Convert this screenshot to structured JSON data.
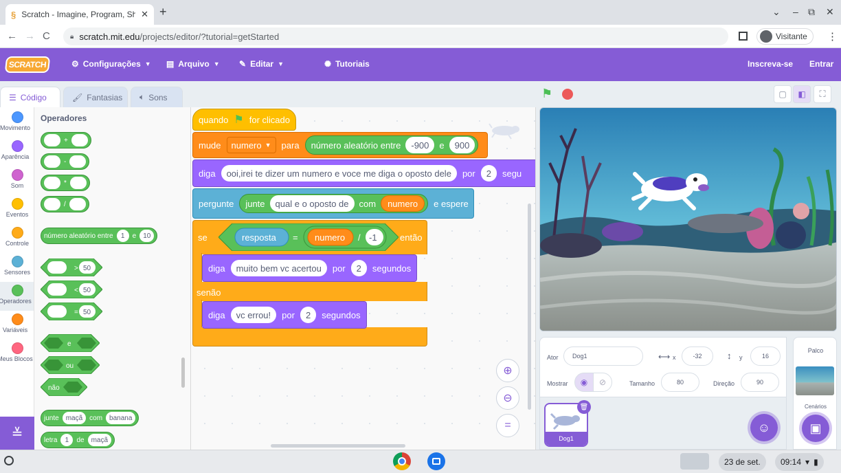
{
  "browser": {
    "tab_title": "Scratch - Imagine, Program, Sha",
    "url_host": "scratch.mit.edu",
    "url_path": "/projects/editor/?tutorial=getStarted",
    "profile": "Visitante"
  },
  "menu": {
    "logo": "SCRATCH",
    "settings": "Configurações",
    "file": "Arquivo",
    "edit": "Editar",
    "tutorials": "Tutoriais",
    "join": "Inscreva-se",
    "signin": "Entrar"
  },
  "tabs": {
    "code": "Código",
    "costumes": "Fantasias",
    "sounds": "Sons"
  },
  "categories": [
    {
      "label": "Movimento",
      "color": "#4c97ff"
    },
    {
      "label": "Aparência",
      "color": "#9966ff"
    },
    {
      "label": "Som",
      "color": "#cf63cf"
    },
    {
      "label": "Eventos",
      "color": "#ffbf00"
    },
    {
      "label": "Controle",
      "color": "#ffab19"
    },
    {
      "label": "Sensores",
      "color": "#5cb1d6"
    },
    {
      "label": "Operadores",
      "color": "#59c059"
    },
    {
      "label": "Variáveis",
      "color": "#ff8c1a"
    },
    {
      "label": "Meus Blocos",
      "color": "#ff6680"
    }
  ],
  "palette": {
    "title": "Operadores",
    "add": "+",
    "sub": "-",
    "mul": "*",
    "div": "/",
    "random_label": "número aleatório entre",
    "random_and": "e",
    "random_from": "1",
    "random_to": "10",
    "gt": ">",
    "lt": "<",
    "eq": "=",
    "cmp_value": "50",
    "and": "e",
    "or": "ou",
    "not": "não",
    "join_label": "junte",
    "join_a": "maçã",
    "join_with": "com",
    "join_b": "banana",
    "letter_label": "letra",
    "letter_n": "1",
    "letter_of": "de",
    "letter_word": "maçã"
  },
  "script": {
    "hat_when": "quando",
    "hat_clicked": "for clicado",
    "set_label": "mude",
    "set_var": "numero",
    "set_to": "para",
    "rand_label": "número aleatório entre",
    "rand_min": "-900",
    "rand_and": "e",
    "rand_max": "900",
    "say_label": "diga",
    "say1_msg": "ooi,irei te dizer um numero e  voce me diga o oposto dele",
    "say1_for": "por",
    "say1_secs": "2",
    "say1_unit": "segu",
    "ask_label": "pergunte",
    "ask_join": "junte",
    "ask_text": "qual e o oposto de",
    "ask_with": "com",
    "ask_var": "numero",
    "ask_wait": "e espere",
    "if_label": "se",
    "if_answer": "resposta",
    "if_eq": "=",
    "if_var": "numero",
    "if_div": "/",
    "if_divisor": "-1",
    "if_then": "então",
    "say2_msg": "muito bem vc acertou",
    "say2_for": "por",
    "say2_secs": "2",
    "say2_unit": "segundos",
    "else_label": "senão",
    "say3_msg": "vc errou!",
    "say3_for": "por",
    "say3_secs": "2",
    "say3_unit": "segundos"
  },
  "sprite": {
    "ator_label": "Ator",
    "name": "Dog1",
    "x_label": "x",
    "x": "-32",
    "y_label": "y",
    "y": "16",
    "show_label": "Mostrar",
    "size_label": "Tamanho",
    "size": "80",
    "dir_label": "Direção",
    "dir": "90",
    "thumb_name": "Dog1"
  },
  "stage_panel": {
    "title": "Palco",
    "backdrops": "Cenários"
  },
  "shelf": {
    "date": "23 de set.",
    "time": "09:14"
  }
}
